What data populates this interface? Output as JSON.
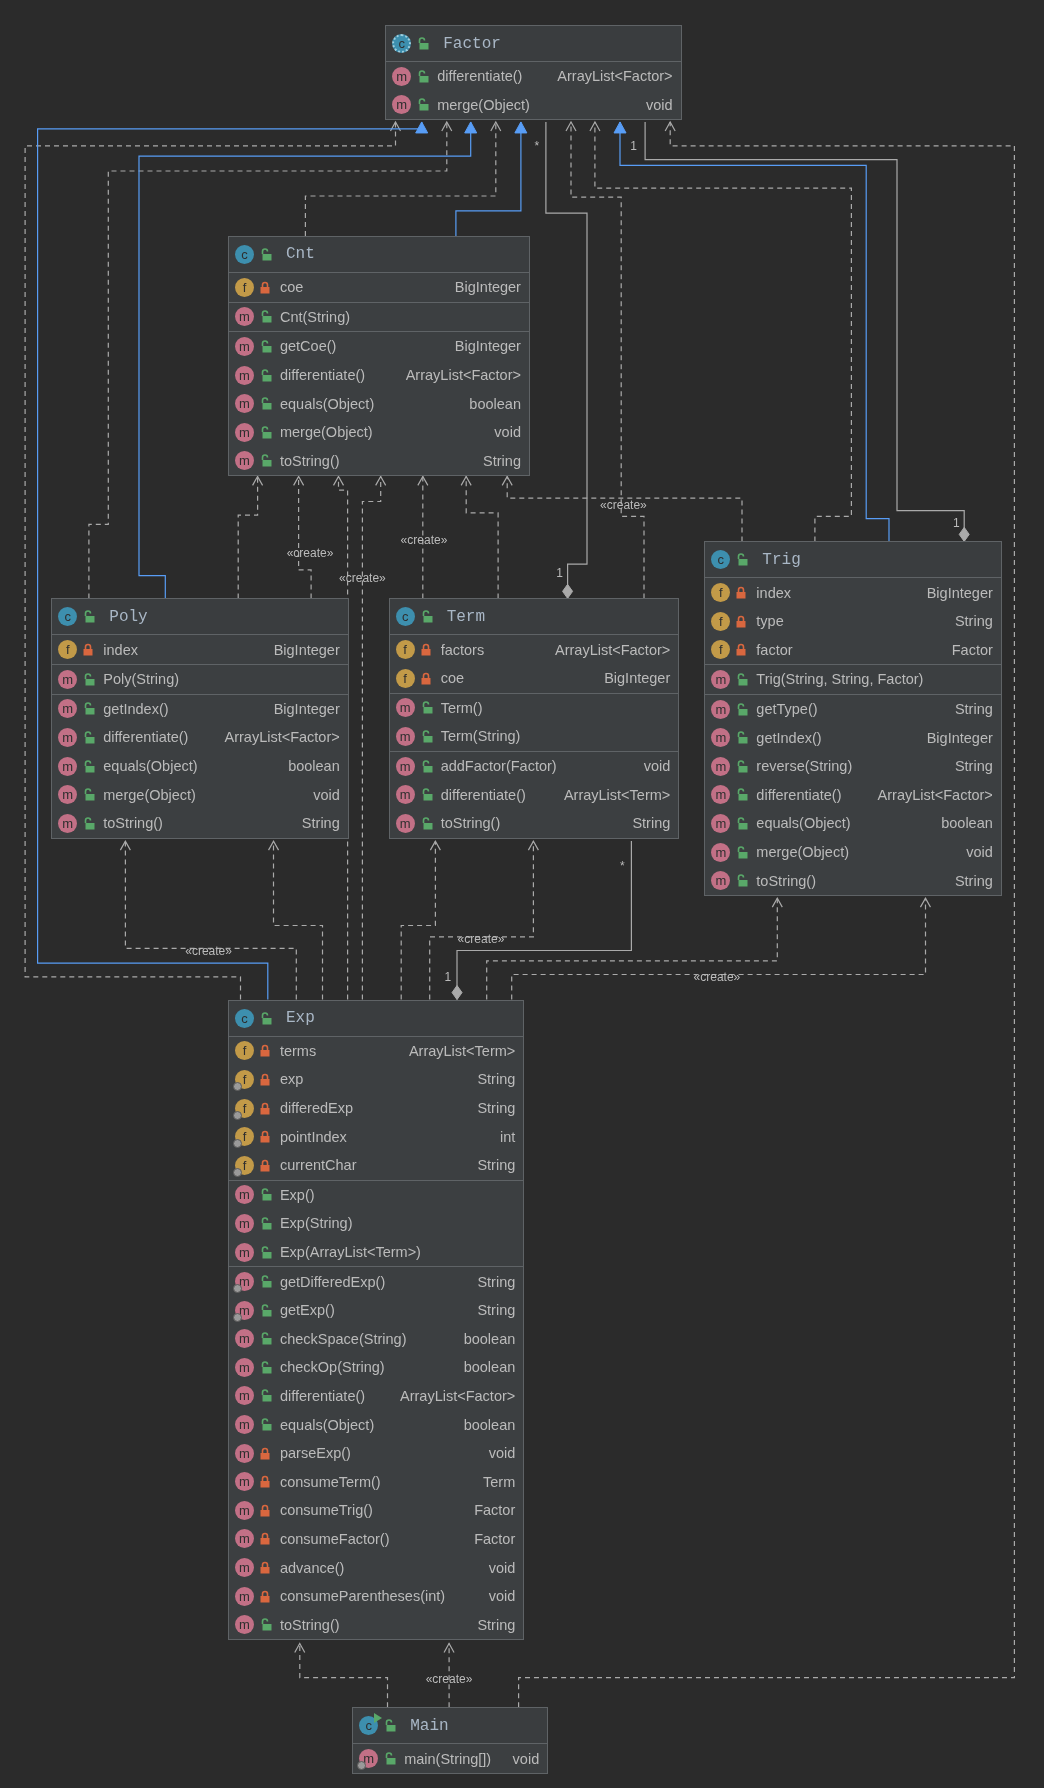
{
  "classes": [
    {
      "name": "Factor",
      "kind": "abstract",
      "icon": "c",
      "private": false,
      "sections": [
        [
          {
            "kind": "method",
            "icon": "m",
            "private": false,
            "static": false,
            "name": "differentiate()",
            "type": "ArrayList<Factor>"
          },
          {
            "kind": "method",
            "icon": "m",
            "private": false,
            "static": false,
            "name": "merge(Object)",
            "type": "void"
          }
        ]
      ]
    },
    {
      "name": "Cnt",
      "kind": "class",
      "icon": "c",
      "private": false,
      "sections": [
        [
          {
            "kind": "field",
            "icon": "f",
            "private": true,
            "static": false,
            "name": "coe",
            "type": "BigInteger"
          }
        ],
        [
          {
            "kind": "method",
            "icon": "m",
            "private": false,
            "static": false,
            "name": "Cnt(String)"
          }
        ],
        [
          {
            "kind": "method",
            "icon": "m",
            "private": false,
            "static": false,
            "name": "getCoe()",
            "type": "BigInteger"
          },
          {
            "kind": "method",
            "icon": "m",
            "private": false,
            "static": false,
            "name": "differentiate()",
            "type": "ArrayList<Factor>"
          },
          {
            "kind": "method",
            "icon": "m",
            "private": false,
            "static": false,
            "name": "equals(Object)",
            "type": "boolean"
          },
          {
            "kind": "method",
            "icon": "m",
            "private": false,
            "static": false,
            "name": "merge(Object)",
            "type": "void"
          },
          {
            "kind": "method",
            "icon": "m",
            "private": false,
            "static": false,
            "name": "toString()",
            "type": "String"
          }
        ]
      ]
    },
    {
      "name": "Poly",
      "kind": "class",
      "icon": "c",
      "private": false,
      "sections": [
        [
          {
            "kind": "field",
            "icon": "f",
            "private": true,
            "static": false,
            "name": "index",
            "type": "BigInteger"
          }
        ],
        [
          {
            "kind": "method",
            "icon": "m",
            "private": false,
            "static": false,
            "name": "Poly(String)"
          }
        ],
        [
          {
            "kind": "method",
            "icon": "m",
            "private": false,
            "static": false,
            "name": "getIndex()",
            "type": "BigInteger"
          },
          {
            "kind": "method",
            "icon": "m",
            "private": false,
            "static": false,
            "name": "differentiate()",
            "type": "ArrayList<Factor>"
          },
          {
            "kind": "method",
            "icon": "m",
            "private": false,
            "static": false,
            "name": "equals(Object)",
            "type": "boolean"
          },
          {
            "kind": "method",
            "icon": "m",
            "private": false,
            "static": false,
            "name": "merge(Object)",
            "type": "void"
          },
          {
            "kind": "method",
            "icon": "m",
            "private": false,
            "static": false,
            "name": "toString()",
            "type": "String"
          }
        ]
      ]
    },
    {
      "name": "Term",
      "kind": "class",
      "icon": "c",
      "private": false,
      "sections": [
        [
          {
            "kind": "field",
            "icon": "f",
            "private": true,
            "static": false,
            "name": "factors",
            "type": "ArrayList<Factor>"
          },
          {
            "kind": "field",
            "icon": "f",
            "private": true,
            "static": false,
            "name": "coe",
            "type": "BigInteger"
          }
        ],
        [
          {
            "kind": "method",
            "icon": "m",
            "private": false,
            "static": false,
            "name": "Term()"
          },
          {
            "kind": "method",
            "icon": "m",
            "private": false,
            "static": false,
            "name": "Term(String)"
          }
        ],
        [
          {
            "kind": "method",
            "icon": "m",
            "private": false,
            "static": false,
            "name": "addFactor(Factor)",
            "type": "void"
          },
          {
            "kind": "method",
            "icon": "m",
            "private": false,
            "static": false,
            "name": "differentiate()",
            "type": "ArrayList<Term>"
          },
          {
            "kind": "method",
            "icon": "m",
            "private": false,
            "static": false,
            "name": "toString()",
            "type": "String"
          }
        ]
      ]
    },
    {
      "name": "Trig",
      "kind": "class",
      "icon": "c",
      "private": false,
      "sections": [
        [
          {
            "kind": "field",
            "icon": "f",
            "private": true,
            "static": false,
            "name": "index",
            "type": "BigInteger"
          },
          {
            "kind": "field",
            "icon": "f",
            "private": true,
            "static": false,
            "name": "type",
            "type": "String"
          },
          {
            "kind": "field",
            "icon": "f",
            "private": true,
            "static": false,
            "name": "factor",
            "type": "Factor"
          }
        ],
        [
          {
            "kind": "method",
            "icon": "m",
            "private": false,
            "static": false,
            "name": "Trig(String, String, Factor)"
          }
        ],
        [
          {
            "kind": "method",
            "icon": "m",
            "private": false,
            "static": false,
            "name": "getType()",
            "type": "String"
          },
          {
            "kind": "method",
            "icon": "m",
            "private": false,
            "static": false,
            "name": "getIndex()",
            "type": "BigInteger"
          },
          {
            "kind": "method",
            "icon": "m",
            "private": false,
            "static": false,
            "name": "reverse(String)",
            "type": "String"
          },
          {
            "kind": "method",
            "icon": "m",
            "private": false,
            "static": false,
            "name": "differentiate()",
            "type": "ArrayList<Factor>"
          },
          {
            "kind": "method",
            "icon": "m",
            "private": false,
            "static": false,
            "name": "equals(Object)",
            "type": "boolean"
          },
          {
            "kind": "method",
            "icon": "m",
            "private": false,
            "static": false,
            "name": "merge(Object)",
            "type": "void"
          },
          {
            "kind": "method",
            "icon": "m",
            "private": false,
            "static": false,
            "name": "toString()",
            "type": "String"
          }
        ]
      ]
    },
    {
      "name": "Exp",
      "kind": "class",
      "icon": "c",
      "private": false,
      "sections": [
        [
          {
            "kind": "field",
            "icon": "f",
            "private": true,
            "static": false,
            "name": "terms",
            "type": "ArrayList<Term>"
          },
          {
            "kind": "field",
            "icon": "f",
            "private": true,
            "static": true,
            "name": "exp",
            "type": "String"
          },
          {
            "kind": "field",
            "icon": "f",
            "private": true,
            "static": true,
            "name": "differedExp",
            "type": "String"
          },
          {
            "kind": "field",
            "icon": "f",
            "private": true,
            "static": true,
            "name": "pointIndex",
            "type": "int"
          },
          {
            "kind": "field",
            "icon": "f",
            "private": true,
            "static": true,
            "name": "currentChar",
            "type": "String"
          }
        ],
        [
          {
            "kind": "method",
            "icon": "m",
            "private": false,
            "static": false,
            "name": "Exp()"
          },
          {
            "kind": "method",
            "icon": "m",
            "private": false,
            "static": false,
            "name": "Exp(String)"
          },
          {
            "kind": "method",
            "icon": "m",
            "private": false,
            "static": false,
            "name": "Exp(ArrayList<Term>)"
          }
        ],
        [
          {
            "kind": "method",
            "icon": "m",
            "private": false,
            "static": true,
            "name": "getDifferedExp()",
            "type": "String"
          },
          {
            "kind": "method",
            "icon": "m",
            "private": false,
            "static": true,
            "name": "getExp()",
            "type": "String"
          },
          {
            "kind": "method",
            "icon": "m",
            "private": false,
            "static": false,
            "name": "checkSpace(String)",
            "type": "boolean"
          },
          {
            "kind": "method",
            "icon": "m",
            "private": false,
            "static": false,
            "name": "checkOp(String)",
            "type": "boolean"
          },
          {
            "kind": "method",
            "icon": "m",
            "private": false,
            "static": false,
            "name": "differentiate()",
            "type": "ArrayList<Factor>"
          },
          {
            "kind": "method",
            "icon": "m",
            "private": false,
            "static": false,
            "name": "equals(Object)",
            "type": "boolean"
          },
          {
            "kind": "method",
            "icon": "m",
            "private": true,
            "static": false,
            "name": "parseExp()",
            "type": "void"
          },
          {
            "kind": "method",
            "icon": "m",
            "private": true,
            "static": false,
            "name": "consumeTerm()",
            "type": "Term"
          },
          {
            "kind": "method",
            "icon": "m",
            "private": true,
            "static": false,
            "name": "consumeTrig()",
            "type": "Factor"
          },
          {
            "kind": "method",
            "icon": "m",
            "private": true,
            "static": false,
            "name": "consumeFactor()",
            "type": "Factor"
          },
          {
            "kind": "method",
            "icon": "m",
            "private": true,
            "static": false,
            "name": "advance()",
            "type": "void"
          },
          {
            "kind": "method",
            "icon": "m",
            "private": true,
            "static": false,
            "name": "consumeParentheses(int)",
            "type": "void"
          },
          {
            "kind": "method",
            "icon": "m",
            "private": false,
            "static": false,
            "name": "toString()",
            "type": "String"
          }
        ]
      ]
    },
    {
      "name": "Main",
      "kind": "main",
      "icon": "c",
      "private": false,
      "sections": [
        [
          {
            "kind": "method",
            "icon": "m",
            "private": false,
            "static": true,
            "name": "main(String[])",
            "type": "void"
          }
        ]
      ]
    }
  ],
  "relations": [
    {
      "kind": "dependency"
    },
    {
      "kind": "realization"
    },
    {
      "kind": "dependency"
    },
    {
      "kind": "realization"
    },
    {
      "kind": "dependency"
    },
    {
      "kind": "realization"
    },
    {
      "kind": "composition",
      "source_multiplicity": "1",
      "target_multiplicity": "*"
    },
    {
      "kind": "dependency"
    },
    {
      "kind": "dependency"
    },
    {
      "kind": "realization"
    },
    {
      "kind": "composition",
      "source_multiplicity": "1",
      "target_multiplicity": "1"
    },
    {
      "kind": "dependency"
    },
    {
      "kind": "dependency"
    },
    {
      "kind": "dependency",
      "label": "«create»"
    },
    {
      "kind": "dependency"
    },
    {
      "kind": "dependency",
      "label": "«create»"
    },
    {
      "kind": "dependency",
      "label": "«create»"
    },
    {
      "kind": "dependency"
    },
    {
      "kind": "dependency",
      "label": "«create»"
    },
    {
      "kind": "dependency",
      "label": "«create»"
    },
    {
      "kind": "dependency"
    },
    {
      "kind": "dependency"
    },
    {
      "kind": "dependency",
      "label": "«create»"
    },
    {
      "kind": "composition",
      "source_multiplicity": "1",
      "target_multiplicity": "*"
    },
    {
      "kind": "dependency"
    },
    {
      "kind": "dependency",
      "label": "«create»"
    },
    {
      "kind": "dependency"
    },
    {
      "kind": "dependency",
      "label": "«create»"
    }
  ]
}
